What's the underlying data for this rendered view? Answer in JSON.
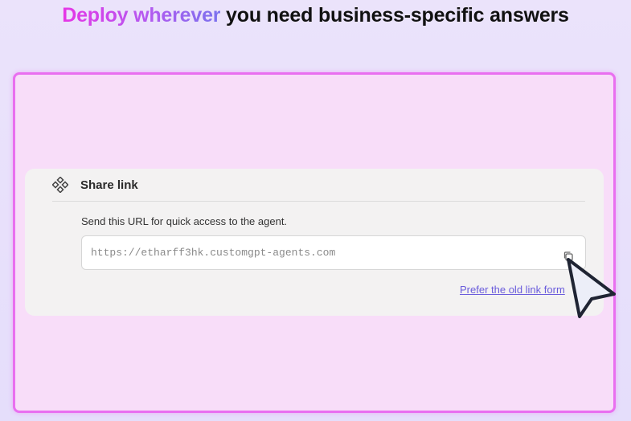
{
  "headline": {
    "highlight": "Deploy wherever",
    "rest": " you need business-specific answers"
  },
  "share_card": {
    "title": "Share link",
    "description": "Send this URL for quick access to the agent.",
    "url": "https://etharff3hk.customgpt-agents.com",
    "old_link_label": "Prefer the old link form"
  },
  "icons": {
    "share": "diamond-cluster-icon",
    "copy": "copy-icon",
    "cursor": "mouse-pointer-icon"
  },
  "colors": {
    "accent_pink": "#e636e6",
    "accent_purple": "#7a72ee",
    "frame_border": "#e96ff0",
    "link": "#6a5cdc"
  }
}
